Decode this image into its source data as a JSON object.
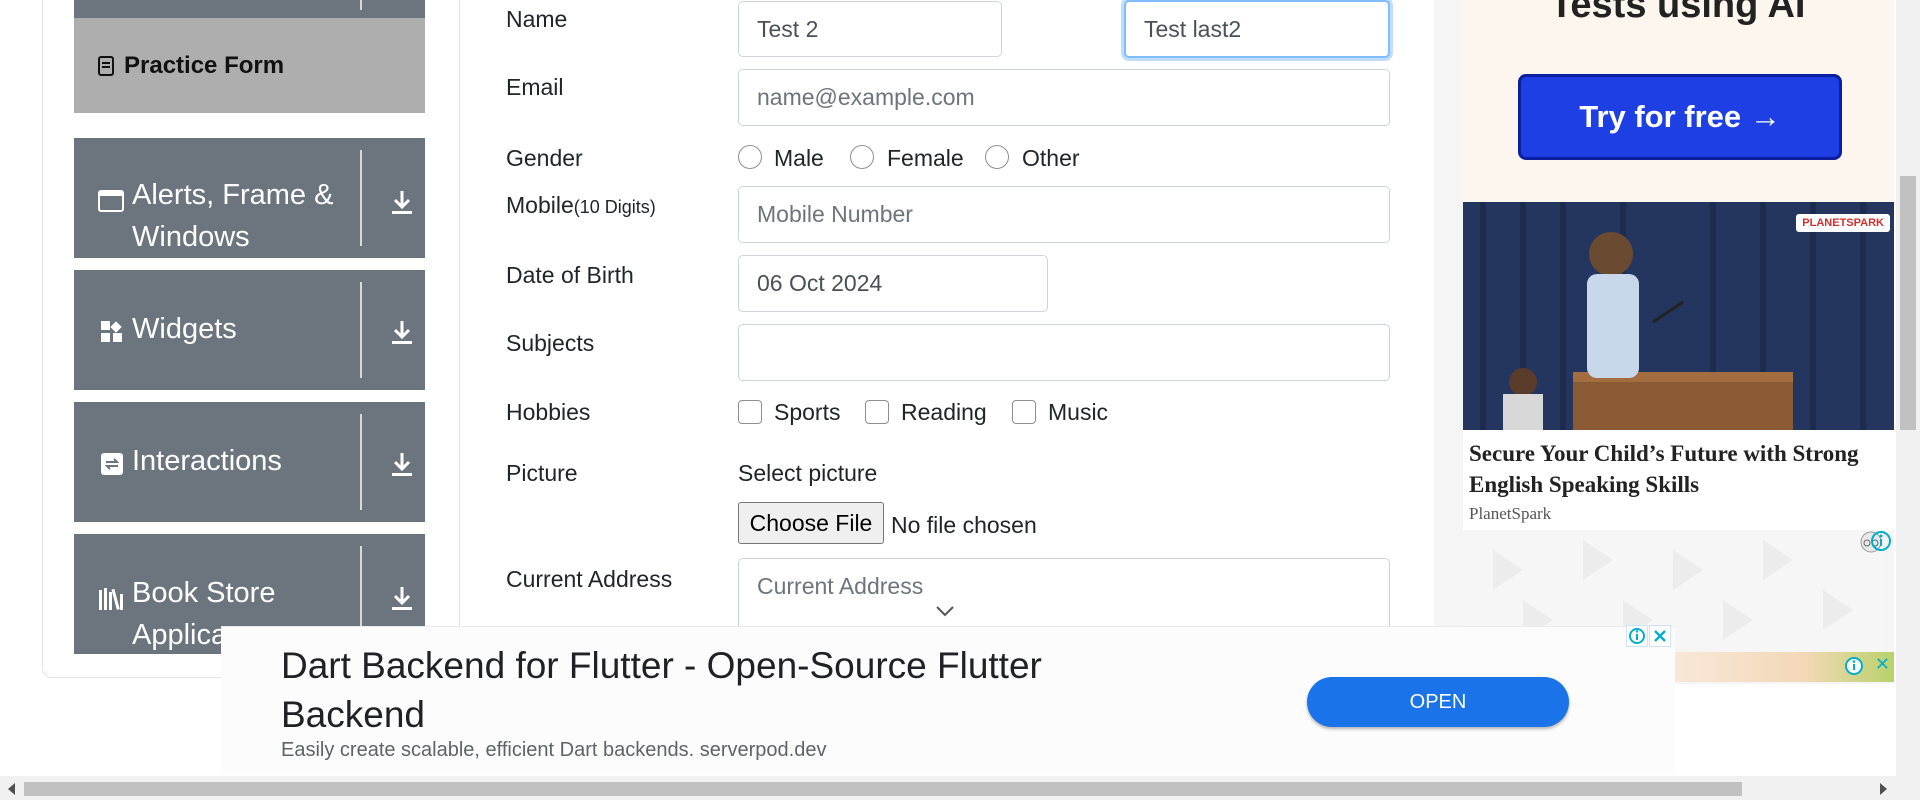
{
  "sidebar": {
    "practice_form": "Practice Form",
    "items": [
      {
        "label_line1": "Alerts, Frame &",
        "label_line2": "Windows",
        "icon": "window-icon"
      },
      {
        "label_line1": "Widgets",
        "label_line2": "",
        "icon": "widgets-icon"
      },
      {
        "label_line1": "Interactions",
        "label_line2": "",
        "icon": "interactions-icon"
      },
      {
        "label_line1": "Book Store",
        "label_line2": "Applica",
        "icon": "books-icon"
      }
    ]
  },
  "form": {
    "name_label": "Name",
    "first_name_value": "Test 2",
    "last_name_value": "Test last2",
    "email_label": "Email",
    "email_placeholder": "name@example.com",
    "gender_label": "Gender",
    "gender_options": [
      "Male",
      "Female",
      "Other"
    ],
    "mobile_label": "Mobile",
    "mobile_hint": "(10 Digits)",
    "mobile_placeholder": "Mobile Number",
    "dob_label": "Date of Birth",
    "dob_value": "06 Oct 2024",
    "subjects_label": "Subjects",
    "subjects_value": "",
    "hobbies_label": "Hobbies",
    "hobbies_options": [
      "Sports",
      "Reading",
      "Music"
    ],
    "picture_label": "Picture",
    "select_picture": "Select picture",
    "choose_file": "Choose File",
    "no_file": "No file chosen",
    "address_label": "Current Address",
    "address_placeholder": "Current Address"
  },
  "right_ad": {
    "headline_fragment": "Tests using AI",
    "cta": "Try for free →",
    "card_title": "Secure Your Child’s Future with Strong English Speaking Skills",
    "card_source": "PlanetSpark",
    "brand_badge": "PLANETSPARK"
  },
  "bottom_ad": {
    "title": "Dart Backend for Flutter - Open-Source Flutter Backend",
    "subtitle": "Easily create scalable, efficient Dart backends. serverpod.dev",
    "cta": "OPEN"
  },
  "colors": {
    "sidebar_bg": "#6c757d",
    "active_item_bg": "#aeaeae",
    "focus_border": "#80bdff",
    "cta_blue": "#1a73e8",
    "try_blue": "#1d3fe3"
  }
}
